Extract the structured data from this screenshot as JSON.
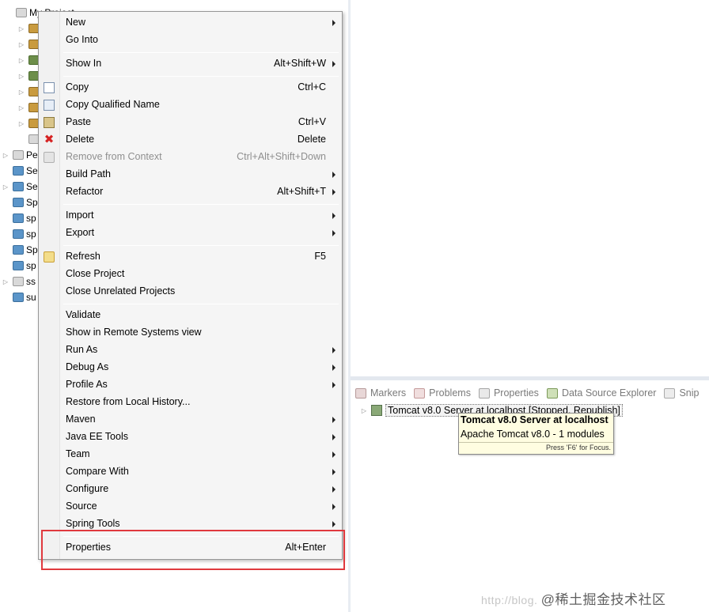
{
  "explorer": {
    "project_label": "My Project",
    "rows": [
      {
        "label": "Pe",
        "icon": "project"
      },
      {
        "label": "Se",
        "icon": "folder"
      },
      {
        "label": "Se",
        "icon": "folder"
      },
      {
        "label": "Sp",
        "icon": "folder"
      },
      {
        "label": "sp",
        "icon": "folder"
      },
      {
        "label": "sp",
        "icon": "folder"
      },
      {
        "label": "Sp",
        "icon": "folder"
      },
      {
        "label": "sp",
        "icon": "folder"
      },
      {
        "label": "ss",
        "icon": "project"
      },
      {
        "label": "su",
        "icon": "folder"
      }
    ]
  },
  "menu": {
    "items": [
      {
        "label": "New",
        "shortcut": "",
        "submenu": true
      },
      {
        "label": "Go Into",
        "shortcut": "",
        "submenu": false
      },
      {
        "label": "Show In",
        "shortcut": "Alt+Shift+W",
        "submenu": true
      },
      {
        "label": "Copy",
        "shortcut": "Ctrl+C",
        "submenu": false
      },
      {
        "label": "Copy Qualified Name",
        "shortcut": "",
        "submenu": false
      },
      {
        "label": "Paste",
        "shortcut": "Ctrl+V",
        "submenu": false
      },
      {
        "label": "Delete",
        "shortcut": "Delete",
        "submenu": false
      },
      {
        "label": "Remove from Context",
        "shortcut": "Ctrl+Alt+Shift+Down",
        "submenu": false,
        "disabled": true
      },
      {
        "label": "Build Path",
        "shortcut": "",
        "submenu": true
      },
      {
        "label": "Refactor",
        "shortcut": "Alt+Shift+T",
        "submenu": true
      },
      {
        "label": "Import",
        "shortcut": "",
        "submenu": true
      },
      {
        "label": "Export",
        "shortcut": "",
        "submenu": true
      },
      {
        "label": "Refresh",
        "shortcut": "F5",
        "submenu": false
      },
      {
        "label": "Close Project",
        "shortcut": "",
        "submenu": false
      },
      {
        "label": "Close Unrelated Projects",
        "shortcut": "",
        "submenu": false
      },
      {
        "label": "Validate",
        "shortcut": "",
        "submenu": false
      },
      {
        "label": "Show in Remote Systems view",
        "shortcut": "",
        "submenu": false
      },
      {
        "label": "Run As",
        "shortcut": "",
        "submenu": true
      },
      {
        "label": "Debug As",
        "shortcut": "",
        "submenu": true
      },
      {
        "label": "Profile As",
        "shortcut": "",
        "submenu": true
      },
      {
        "label": "Restore from Local History...",
        "shortcut": "",
        "submenu": false
      },
      {
        "label": "Maven",
        "shortcut": "",
        "submenu": true
      },
      {
        "label": "Java EE Tools",
        "shortcut": "",
        "submenu": true
      },
      {
        "label": "Team",
        "shortcut": "",
        "submenu": true
      },
      {
        "label": "Compare With",
        "shortcut": "",
        "submenu": true
      },
      {
        "label": "Configure",
        "shortcut": "",
        "submenu": true
      },
      {
        "label": "Source",
        "shortcut": "",
        "submenu": true
      },
      {
        "label": "Spring Tools",
        "shortcut": "",
        "submenu": true
      },
      {
        "label": "Properties",
        "shortcut": "Alt+Enter",
        "submenu": false
      }
    ]
  },
  "views": {
    "tabs": [
      "Markers",
      "Problems",
      "Properties",
      "Data Source Explorer",
      "Snip"
    ],
    "server_label": "Tomcat v8.0 Server at localhost  [Stopped, Republish]"
  },
  "tooltip": {
    "title": "Tomcat v8.0 Server at localhost",
    "description": "Apache Tomcat v8.0 - 1 modules",
    "hint": "Press 'F6' for Focus."
  },
  "watermark": {
    "url": "http://blog.",
    "cn": "@稀土掘金技术社区"
  },
  "colors": {
    "highlight_box": "#e0393e",
    "delete_icon": "#d62323",
    "tooltip_bg": "#fffde1"
  }
}
